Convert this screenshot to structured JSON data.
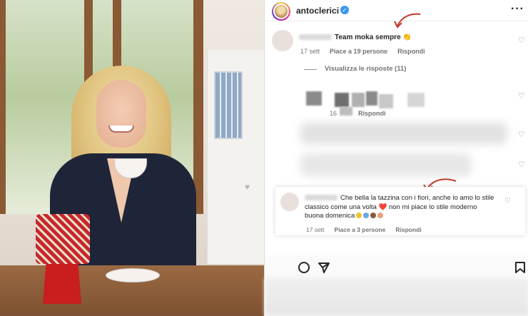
{
  "post": {
    "username": "antoclerici",
    "verified_icon": "verified-badge-icon",
    "more_icon": "more-dots-icon"
  },
  "comments": [
    {
      "text": "Team moka sempre 👏",
      "time": "17 sett",
      "likes": "Piace a 19 persone",
      "reply": "Rispondi"
    },
    {
      "text": "Che bella la tazzina con i fiori, anche io amo lo stile classico come una volta ❤️ non mi piace lo stile moderno buona domenica",
      "time": "17 sett",
      "likes": "Piace a 3 persone",
      "reply": "Rispondi"
    }
  ],
  "thread": {
    "view_replies": "Visualizza le risposte (11)"
  },
  "blurred_comment": {
    "likes_prefix": "16",
    "reply": "Rispondi"
  },
  "colors": {
    "arrow": "#c0392b",
    "verified": "#3897f0",
    "meta": "#737373"
  }
}
